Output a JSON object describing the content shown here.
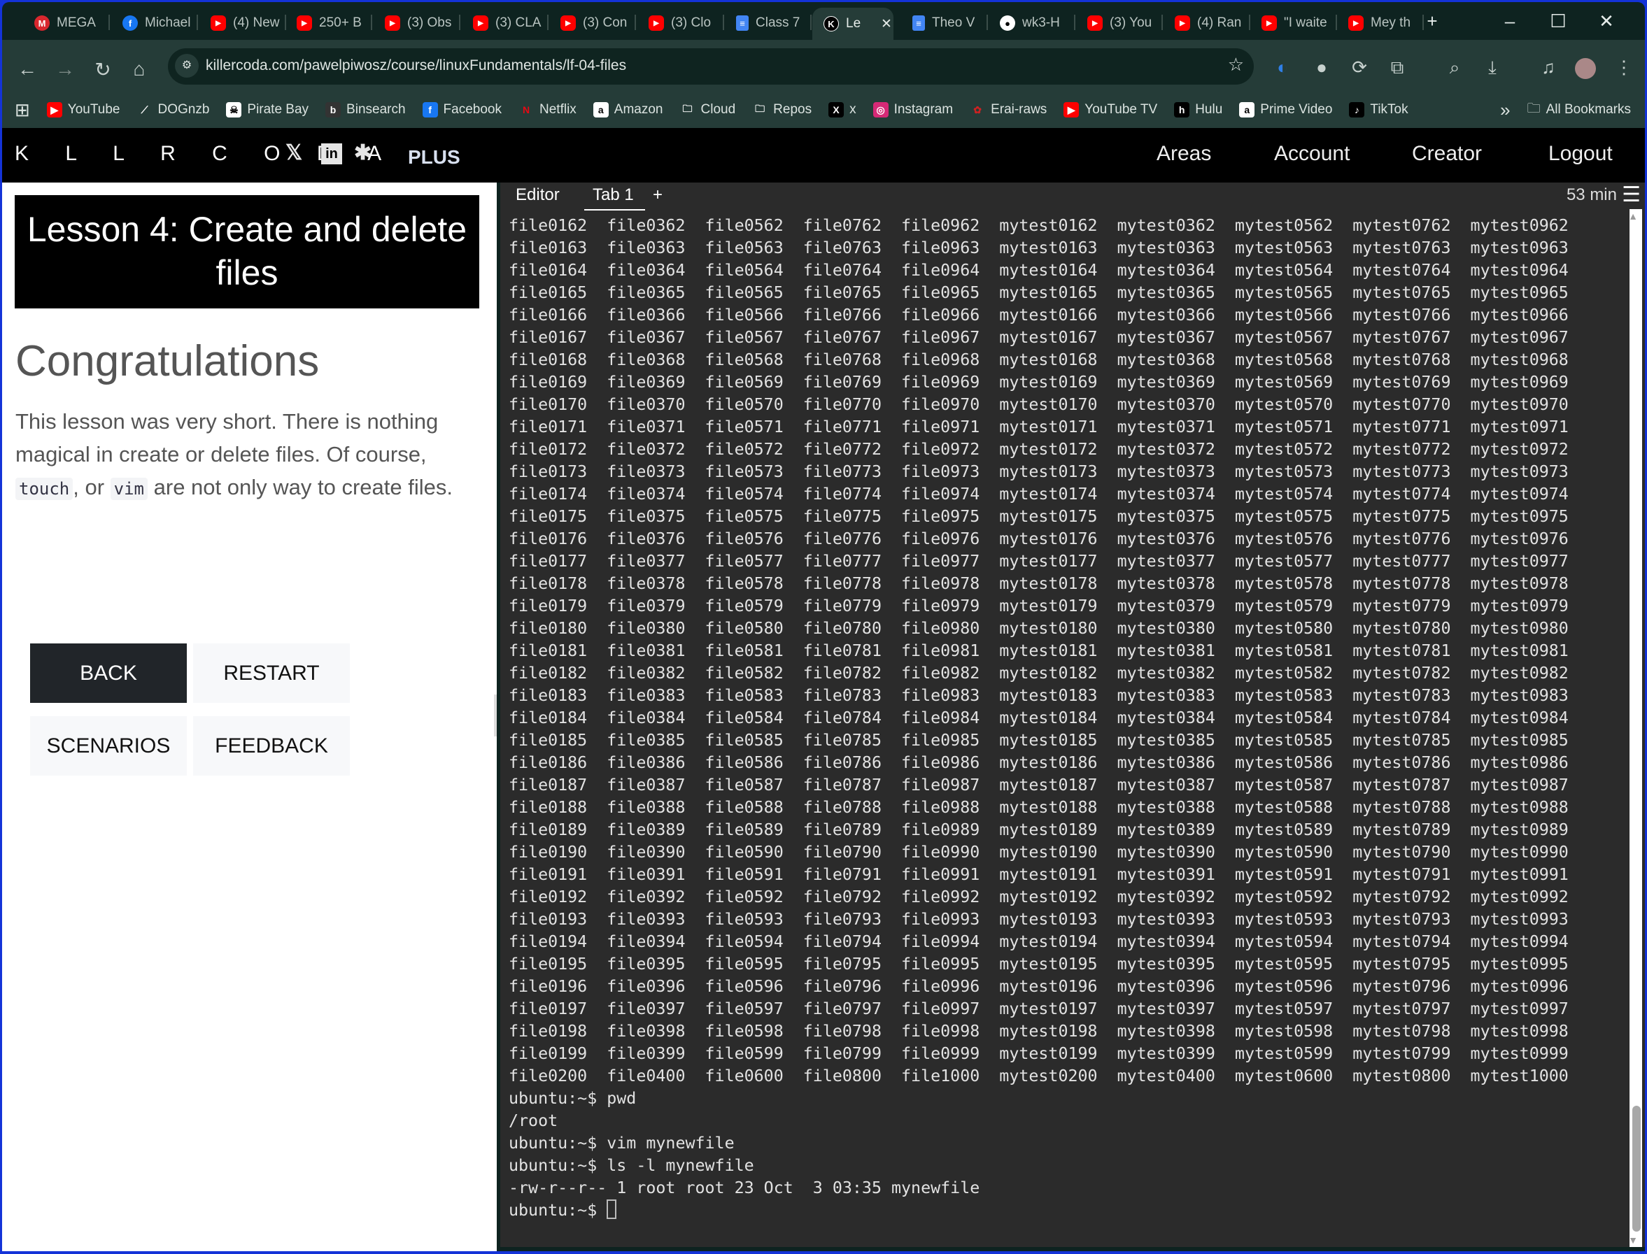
{
  "browser": {
    "tabs": [
      {
        "label": "MEGA",
        "icon": "mega-icon"
      },
      {
        "label": "Michael",
        "icon": "facebook-icon"
      },
      {
        "label": "(4) New",
        "icon": "youtube-icon"
      },
      {
        "label": "250+ B",
        "icon": "youtube-icon"
      },
      {
        "label": "(3) Obs",
        "icon": "youtube-icon"
      },
      {
        "label": "(3) CLA",
        "icon": "youtube-icon"
      },
      {
        "label": "(3) Con",
        "icon": "youtube-icon"
      },
      {
        "label": "(3) Clo",
        "icon": "youtube-icon"
      },
      {
        "label": "Class 7",
        "icon": "docs-icon"
      },
      {
        "label": "Le",
        "icon": "killercoda-icon",
        "active": true
      },
      {
        "label": "Theo V",
        "icon": "docs-icon"
      },
      {
        "label": "wk3-H",
        "icon": "github-icon"
      },
      {
        "label": "(3) You",
        "icon": "youtube-icon"
      },
      {
        "label": "(4) Ran",
        "icon": "youtube-icon"
      },
      {
        "label": "\"I waite",
        "icon": "youtube-icon"
      },
      {
        "label": "Mey th",
        "icon": "youtube-icon"
      }
    ],
    "url": "killercoda.com/pawelpiwosz/course/linuxFundamentals/lf-04-files",
    "bookmarks": [
      "YouTube",
      "DOGnzb",
      "Pirate Bay",
      "Binsearch",
      "Facebook",
      "Netflix",
      "Amazon",
      "Cloud",
      "Repos",
      "x",
      "Instagram",
      "Erai-raws",
      "YouTube TV",
      "Hulu",
      "Prime Video",
      "TikTok"
    ],
    "all_bookmarks": "All Bookmarks"
  },
  "site": {
    "logo": "KILLERCODA",
    "logo_display": "K L L R C O D A",
    "plus": "PLUS",
    "nav": [
      "Areas",
      "Account",
      "Creator",
      "Logout"
    ]
  },
  "lesson": {
    "title": "Lesson 4: Create and delete files",
    "heading": "Congratulations",
    "para1": "This lesson was very short. There is nothing magical in create or delete files. Of course, ",
    "code1": "touch",
    "sep": ", or ",
    "code2": "vim",
    "para2": " are not only way to create files.",
    "buttons": {
      "back": "BACK",
      "restart": "RESTART",
      "scenarios": "SCENARIOS",
      "feedback": "FEEDBACK"
    }
  },
  "terminal": {
    "tabs": {
      "editor": "Editor",
      "tab1": "Tab 1",
      "add": "+"
    },
    "timer": "53 min",
    "lines": [
      "file0162  file0362  file0562  file0762  file0962  mytest0162  mytest0362  mytest0562  mytest0762  mytest0962",
      "file0163  file0363  file0563  file0763  file0963  mytest0163  mytest0363  mytest0563  mytest0763  mytest0963",
      "file0164  file0364  file0564  file0764  file0964  mytest0164  mytest0364  mytest0564  mytest0764  mytest0964",
      "file0165  file0365  file0565  file0765  file0965  mytest0165  mytest0365  mytest0565  mytest0765  mytest0965",
      "file0166  file0366  file0566  file0766  file0966  mytest0166  mytest0366  mytest0566  mytest0766  mytest0966",
      "file0167  file0367  file0567  file0767  file0967  mytest0167  mytest0367  mytest0567  mytest0767  mytest0967",
      "file0168  file0368  file0568  file0768  file0968  mytest0168  mytest0368  mytest0568  mytest0768  mytest0968",
      "file0169  file0369  file0569  file0769  file0969  mytest0169  mytest0369  mytest0569  mytest0769  mytest0969",
      "file0170  file0370  file0570  file0770  file0970  mytest0170  mytest0370  mytest0570  mytest0770  mytest0970",
      "file0171  file0371  file0571  file0771  file0971  mytest0171  mytest0371  mytest0571  mytest0771  mytest0971",
      "file0172  file0372  file0572  file0772  file0972  mytest0172  mytest0372  mytest0572  mytest0772  mytest0972",
      "file0173  file0373  file0573  file0773  file0973  mytest0173  mytest0373  mytest0573  mytest0773  mytest0973",
      "file0174  file0374  file0574  file0774  file0974  mytest0174  mytest0374  mytest0574  mytest0774  mytest0974",
      "file0175  file0375  file0575  file0775  file0975  mytest0175  mytest0375  mytest0575  mytest0775  mytest0975",
      "file0176  file0376  file0576  file0776  file0976  mytest0176  mytest0376  mytest0576  mytest0776  mytest0976",
      "file0177  file0377  file0577  file0777  file0977  mytest0177  mytest0377  mytest0577  mytest0777  mytest0977",
      "file0178  file0378  file0578  file0778  file0978  mytest0178  mytest0378  mytest0578  mytest0778  mytest0978",
      "file0179  file0379  file0579  file0779  file0979  mytest0179  mytest0379  mytest0579  mytest0779  mytest0979",
      "file0180  file0380  file0580  file0780  file0980  mytest0180  mytest0380  mytest0580  mytest0780  mytest0980",
      "file0181  file0381  file0581  file0781  file0981  mytest0181  mytest0381  mytest0581  mytest0781  mytest0981",
      "file0182  file0382  file0582  file0782  file0982  mytest0182  mytest0382  mytest0582  mytest0782  mytest0982",
      "file0183  file0383  file0583  file0783  file0983  mytest0183  mytest0383  mytest0583  mytest0783  mytest0983",
      "file0184  file0384  file0584  file0784  file0984  mytest0184  mytest0384  mytest0584  mytest0784  mytest0984",
      "file0185  file0385  file0585  file0785  file0985  mytest0185  mytest0385  mytest0585  mytest0785  mytest0985",
      "file0186  file0386  file0586  file0786  file0986  mytest0186  mytest0386  mytest0586  mytest0786  mytest0986",
      "file0187  file0387  file0587  file0787  file0987  mytest0187  mytest0387  mytest0587  mytest0787  mytest0987",
      "file0188  file0388  file0588  file0788  file0988  mytest0188  mytest0388  mytest0588  mytest0788  mytest0988",
      "file0189  file0389  file0589  file0789  file0989  mytest0189  mytest0389  mytest0589  mytest0789  mytest0989",
      "file0190  file0390  file0590  file0790  file0990  mytest0190  mytest0390  mytest0590  mytest0790  mytest0990",
      "file0191  file0391  file0591  file0791  file0991  mytest0191  mytest0391  mytest0591  mytest0791  mytest0991",
      "file0192  file0392  file0592  file0792  file0992  mytest0192  mytest0392  mytest0592  mytest0792  mytest0992",
      "file0193  file0393  file0593  file0793  file0993  mytest0193  mytest0393  mytest0593  mytest0793  mytest0993",
      "file0194  file0394  file0594  file0794  file0994  mytest0194  mytest0394  mytest0594  mytest0794  mytest0994",
      "file0195  file0395  file0595  file0795  file0995  mytest0195  mytest0395  mytest0595  mytest0795  mytest0995",
      "file0196  file0396  file0596  file0796  file0996  mytest0196  mytest0396  mytest0596  mytest0796  mytest0996",
      "file0197  file0397  file0597  file0797  file0997  mytest0197  mytest0397  mytest0597  mytest0797  mytest0997",
      "file0198  file0398  file0598  file0798  file0998  mytest0198  mytest0398  mytest0598  mytest0798  mytest0998",
      "file0199  file0399  file0599  file0799  file0999  mytest0199  mytest0399  mytest0599  mytest0799  mytest0999",
      "file0200  file0400  file0600  file0800  file1000  mytest0200  mytest0400  mytest0600  mytest0800  mytest1000",
      "ubuntu:~$ pwd",
      "/root",
      "ubuntu:~$ vim mynewfile",
      "ubuntu:~$ ls -l mynewfile",
      "-rw-r--r-- 1 root root 23 Oct  3 03:35 mynewfile"
    ],
    "prompt": "ubuntu:~$ "
  }
}
